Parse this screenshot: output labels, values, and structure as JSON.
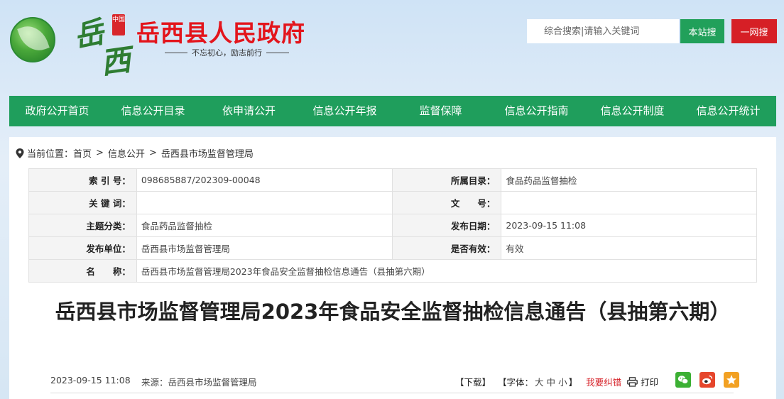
{
  "header": {
    "calligraphy": "岳西",
    "seal": "中国",
    "site_title": "岳西县人民政府",
    "slogan": "不忘初心，励志前行",
    "search_placeholder": "综合搜索|请输入关键词",
    "btn_site": "本站搜",
    "btn_web": "一网搜"
  },
  "nav": [
    "政府公开首页",
    "信息公开目录",
    "依申请公开",
    "信息公开年报",
    "监督保障",
    "信息公开指南",
    "信息公开制度",
    "信息公开统计"
  ],
  "breadcrumb": {
    "prefix": "当前位置：",
    "items": [
      "首页",
      "信息公开",
      "岳西县市场监督管理局"
    ],
    "sep": ">"
  },
  "meta": {
    "index_label": "索 引 号：",
    "index_value": "098685887/202309-00048",
    "catalog_label": "所属目录：",
    "catalog_value": "食品药品监督抽检",
    "keyword_label": "关 键 词：",
    "keyword_value": "",
    "docno_label": "文　　号：",
    "docno_value": "",
    "topic_label": "主题分类：",
    "topic_value": "食品药品监督抽检",
    "pubdate_label": "发布日期：",
    "pubdate_value": "2023-09-15 11:08",
    "unit_label": "发布单位：",
    "unit_value": "岳西县市场监督管理局",
    "valid_label": "是否有效：",
    "valid_value": "有效",
    "name_label": "名　　称：",
    "name_value": "岳西县市场监督管理局2023年食品安全监督抽检信息通告（县抽第六期）"
  },
  "article": {
    "title": "岳西县市场监督管理局2023年食品安全监督抽检信息通告（县抽第六期）",
    "date": "2023-09-15 11:08",
    "source": "来源：岳西县市场监督管理局",
    "download": "【下载】",
    "font_open": "【字体：",
    "font_large": "大",
    "font_medium": "中",
    "font_small": "小",
    "font_close": "】",
    "report": "我要纠错",
    "print": "打印"
  },
  "colors": {
    "nav_green": "#1f9e5c",
    "title_red": "#e3151c",
    "btn_red": "#d61f26"
  }
}
